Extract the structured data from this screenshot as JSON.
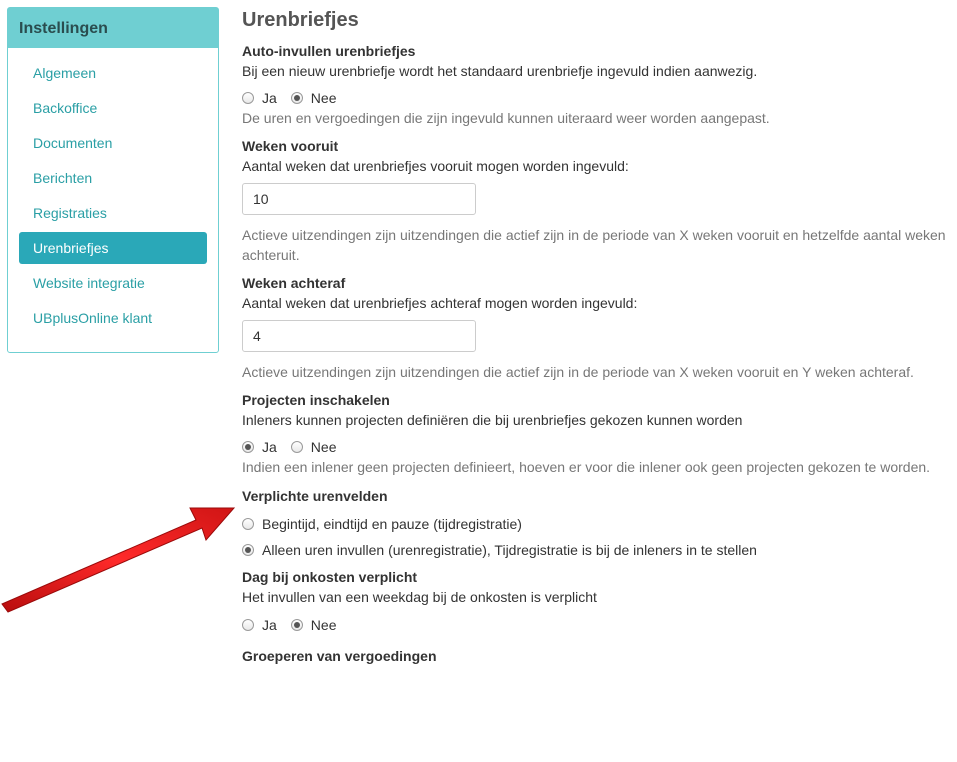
{
  "sidebar": {
    "title": "Instellingen",
    "items": [
      {
        "label": "Algemeen"
      },
      {
        "label": "Backoffice"
      },
      {
        "label": "Documenten"
      },
      {
        "label": "Berichten"
      },
      {
        "label": "Registraties"
      },
      {
        "label": "Urenbriefjes"
      },
      {
        "label": "Website integratie"
      },
      {
        "label": "UBplusOnline klant"
      }
    ],
    "active_index": 5
  },
  "page": {
    "title": "Urenbriefjes"
  },
  "auto_fill": {
    "title": "Auto-invullen urenbriefjes",
    "desc": "Bij een nieuw urenbriefje wordt het standaard urenbriefje ingevuld indien aanwezig.",
    "opt_yes": "Ja",
    "opt_no": "Nee",
    "selected": "Nee",
    "help": "De uren en vergoedingen die zijn ingevuld kunnen uiteraard weer worden aangepast."
  },
  "weeks_ahead": {
    "title": "Weken vooruit",
    "desc": "Aantal weken dat urenbriefjes vooruit mogen worden ingevuld:",
    "value": "10",
    "help": "Actieve uitzendingen zijn uitzendingen die actief zijn in de periode van X weken vooruit en hetzelfde aantal weken achteruit."
  },
  "weeks_back": {
    "title": "Weken achteraf",
    "desc": "Aantal weken dat urenbriefjes achteraf mogen worden ingevuld:",
    "value": "4",
    "help": "Actieve uitzendingen zijn uitzendingen die actief zijn in de periode van X weken vooruit en Y weken achteraf."
  },
  "projects": {
    "title": "Projecten inschakelen",
    "desc": "Inleners kunnen projecten definiëren die bij urenbriefjes gekozen kunnen worden",
    "opt_yes": "Ja",
    "opt_no": "Nee",
    "selected": "Ja",
    "help": "Indien een inlener geen projecten definieert, hoeven er voor die inlener ook geen projecten gekozen te worden."
  },
  "required_fields": {
    "title": "Verplichte urenvelden",
    "opt_1": "Begintijd, eindtijd en pauze (tijdregistratie)",
    "opt_2": "Alleen uren invullen (urenregistratie), Tijdregistratie is bij de inleners in te stellen",
    "selected": "opt_2"
  },
  "day_expenses": {
    "title": "Dag bij onkosten verplicht",
    "desc": "Het invullen van een weekdag bij de onkosten is verplicht",
    "opt_yes": "Ja",
    "opt_no": "Nee",
    "selected": "Nee"
  },
  "group_expenses": {
    "title": "Groeperen van vergoedingen"
  },
  "colors": {
    "sidebar_header": "#6fcfd2",
    "active_item": "#2aa8b8",
    "link": "#2a9fa5",
    "arrow": "#e01b1b"
  },
  "icons": {
    "annotation": "red-arrow-icon"
  }
}
